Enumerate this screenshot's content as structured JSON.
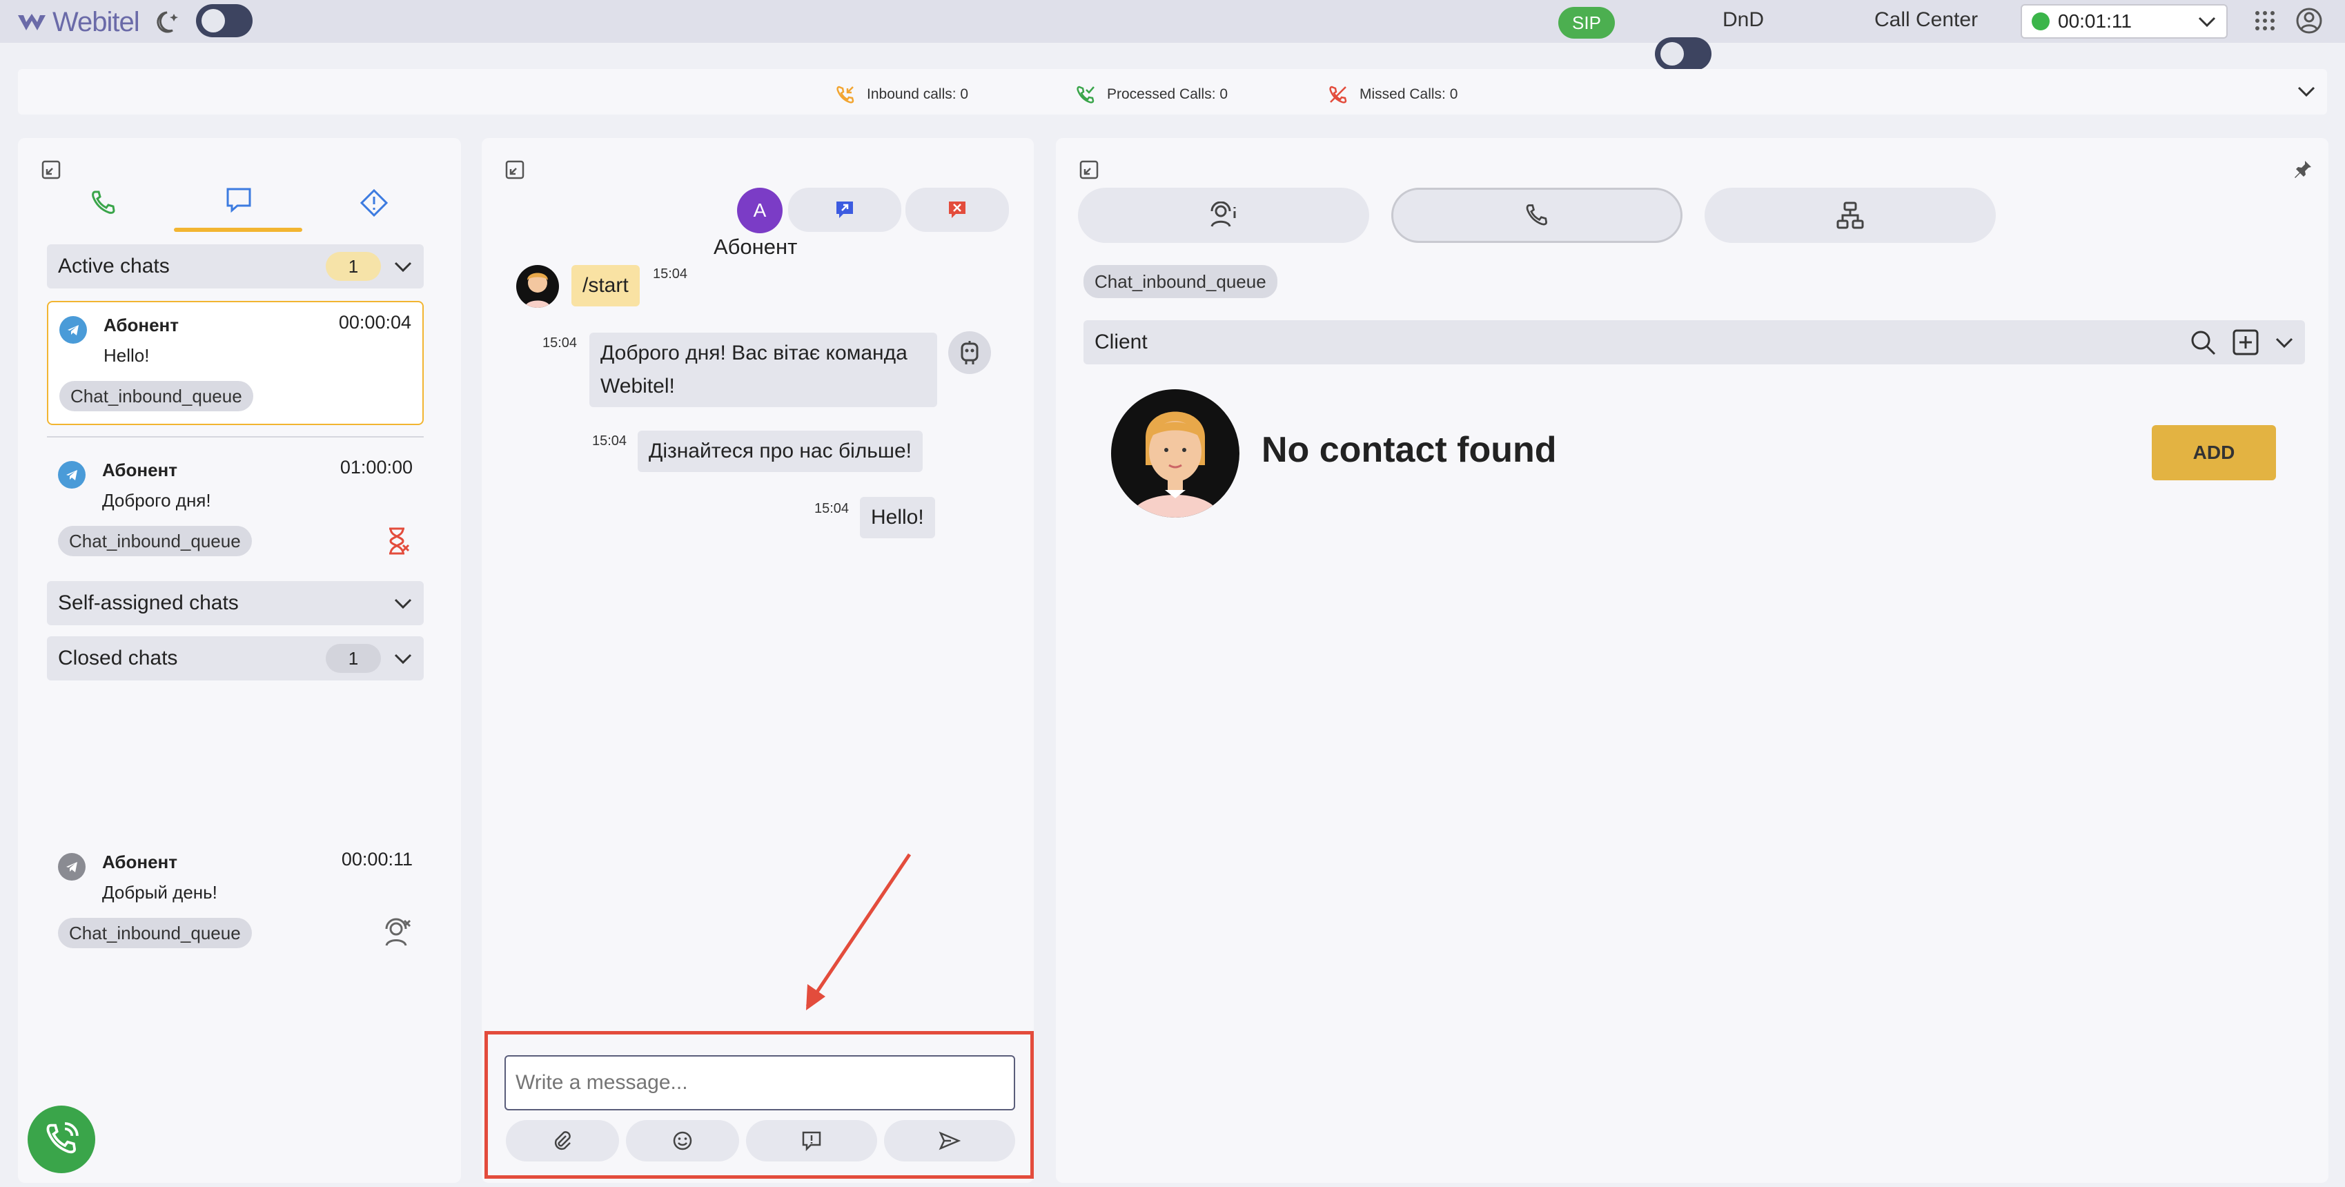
{
  "app": {
    "logo_text": "Webitel"
  },
  "topbar": {
    "sip": "SIP",
    "dnd": "DnD",
    "call_center": "Call Center",
    "timer": "00:01:11"
  },
  "stats": {
    "inbound": "Inbound calls: 0",
    "processed": "Processed Calls: 0",
    "missed": "Missed Calls: 0"
  },
  "left": {
    "active_chats": {
      "title": "Active chats",
      "count": "1"
    },
    "chats": [
      {
        "name": "Абонент",
        "time": "00:00:04",
        "message": "Hello!",
        "queue": "Chat_inbound_queue"
      },
      {
        "name": "Абонент",
        "time": "01:00:00",
        "message": "Доброго дня!",
        "queue": "Chat_inbound_queue"
      }
    ],
    "self_assigned": {
      "title": "Self-assigned chats"
    },
    "closed_chats": {
      "title": "Closed chats",
      "count": "1"
    },
    "closed": [
      {
        "name": "Абонент",
        "time": "00:00:11",
        "message": "Добрый день!",
        "queue": "Chat_inbound_queue"
      }
    ]
  },
  "middle": {
    "avatar_letter": "A",
    "contact_name": "Абонент",
    "messages": [
      {
        "text": "/start",
        "time": "15:04"
      },
      {
        "text": "Доброго дня! Вас вітає команда Webitel!",
        "time": "15:04"
      },
      {
        "text": "Дізнайтеся про нас більше!",
        "time": "15:04"
      },
      {
        "text": "Hello!",
        "time": "15:04"
      }
    ],
    "input_placeholder": "Write a message..."
  },
  "right": {
    "queue_tag": "Chat_inbound_queue",
    "client_label": "Client",
    "no_contact": "No contact found",
    "add_button": "ADD"
  },
  "colors": {
    "accent": "#f2b531",
    "brand": "#6a6aa8",
    "green": "#4caf50",
    "red": "#e34c3c"
  }
}
